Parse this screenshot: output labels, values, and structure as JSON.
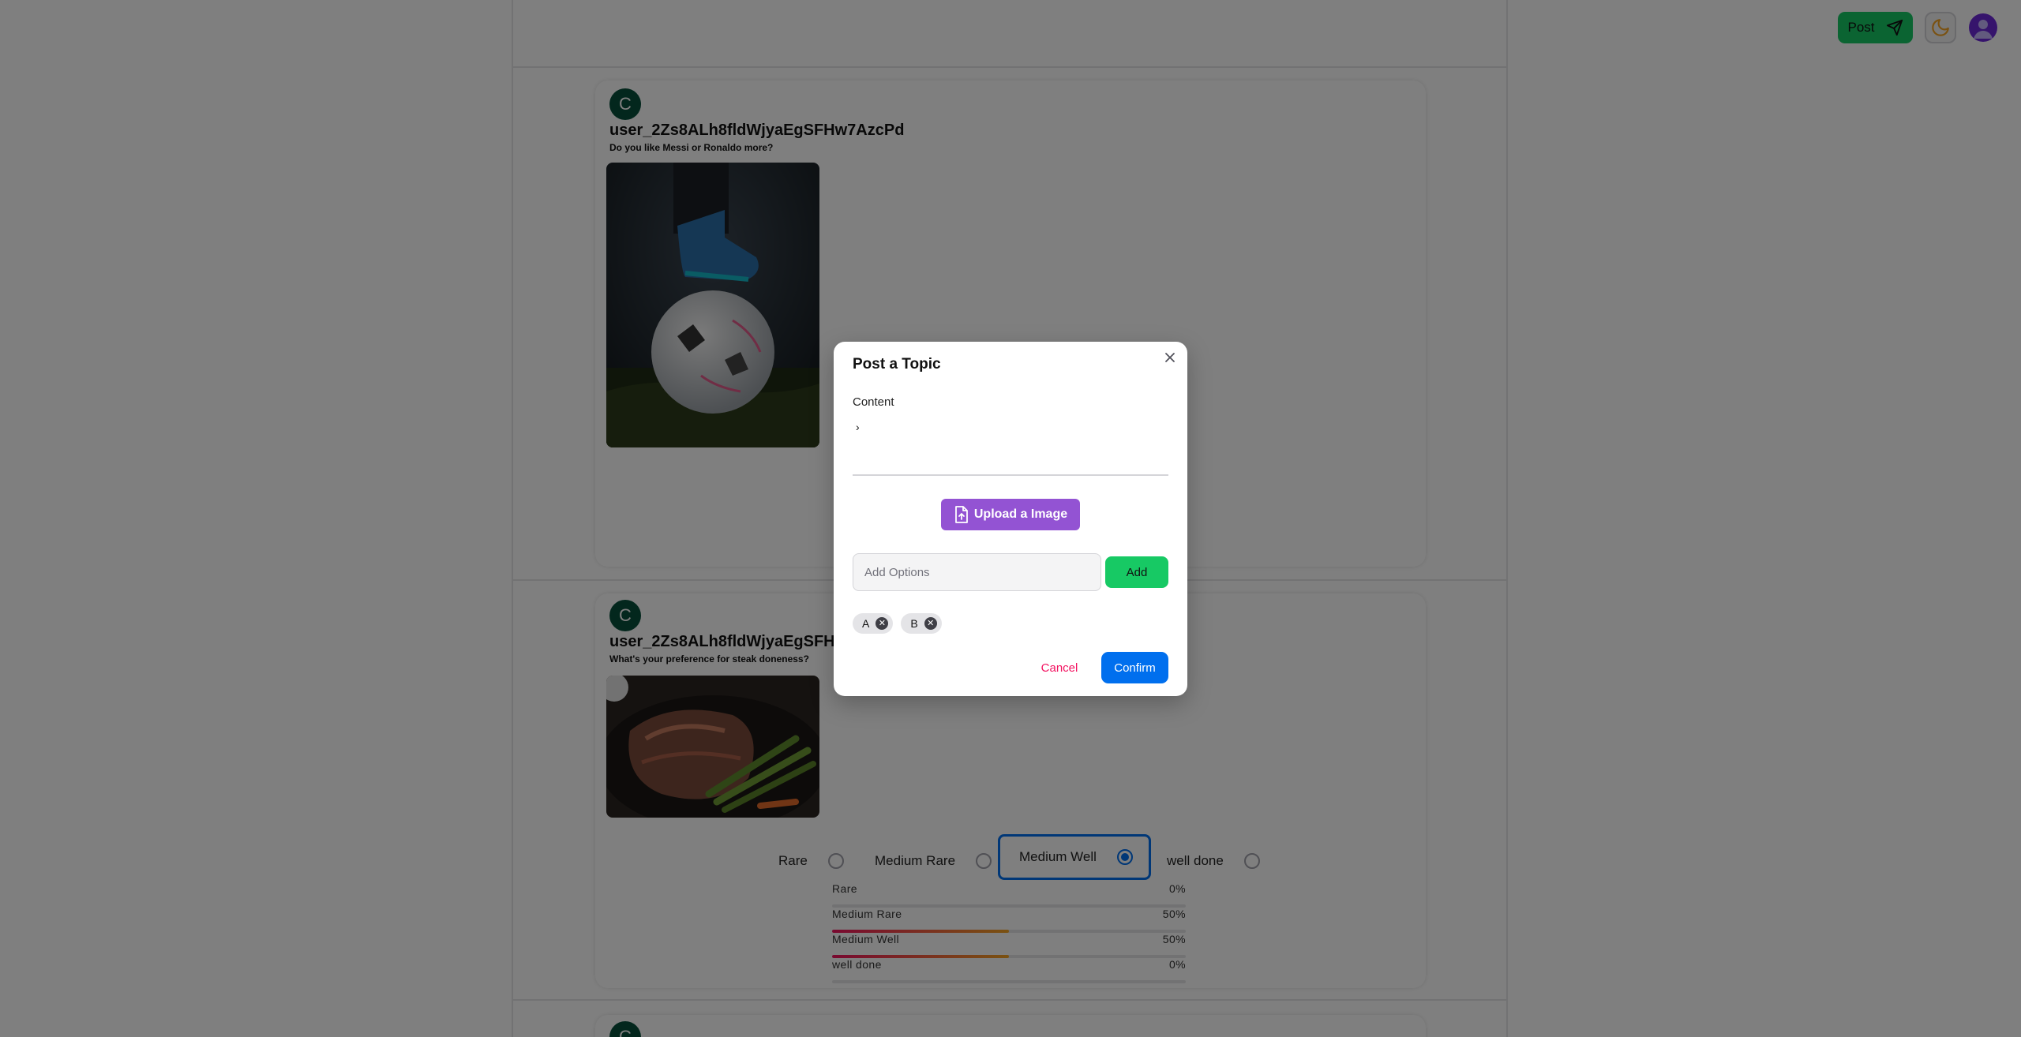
{
  "header": {
    "post_label": "Post",
    "icons": {
      "post": "send-icon",
      "theme": "moon-icon",
      "profile": "avatar"
    }
  },
  "feed": {
    "posts": [
      {
        "avatar_letter": "C",
        "username": "user_2Zs8ALh8fldWjyaEgSFHw7AzcPd",
        "question": "Do you like Messi or Ronaldo more?",
        "image": "soccer-ball-photo"
      },
      {
        "avatar_letter": "C",
        "username": "user_2Zs8ALh8fldWjyaEgSFHw7AzcPd",
        "question": "What's your preference for steak doneness?",
        "image": "steak-photo",
        "options": [
          "Rare",
          "Medium Rare",
          "Medium Well",
          "well done"
        ],
        "selected_option": "Medium Well",
        "results": [
          {
            "label": "Rare",
            "percent_text": "0%",
            "percent": 0
          },
          {
            "label": "Medium Rare",
            "percent_text": "50%",
            "percent": 50
          },
          {
            "label": "Medium Well",
            "percent_text": "50%",
            "percent": 50
          },
          {
            "label": "well done",
            "percent_text": "0%",
            "percent": 0
          }
        ]
      },
      {
        "avatar_letter": "C"
      }
    ]
  },
  "modal": {
    "title": "Post a Topic",
    "content_label": "Content",
    "content_value": "›",
    "upload_label": "Upload a Image",
    "options_placeholder": "Add Options",
    "add_label": "Add",
    "chips": [
      "A",
      "B"
    ],
    "cancel_label": "Cancel",
    "confirm_label": "Confirm"
  },
  "colors": {
    "primary": "#006fee",
    "success": "#17c964",
    "secondary": "#9353d3",
    "danger": "#f31260",
    "avatar_bg": "#064e3b"
  }
}
